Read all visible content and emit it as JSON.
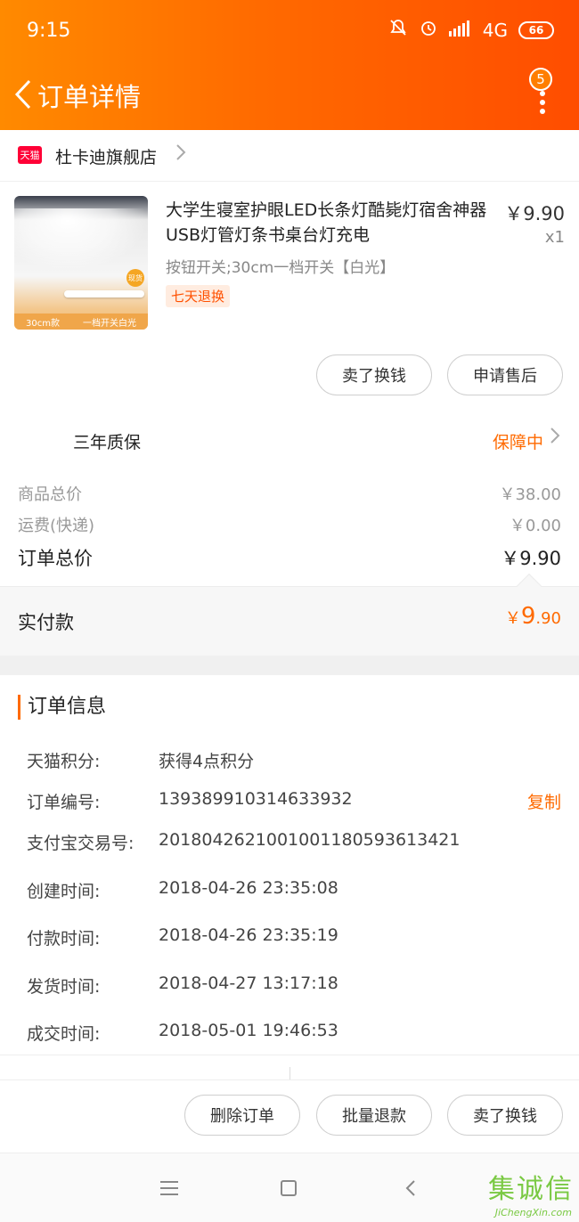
{
  "status_bar": {
    "time": "9:15",
    "network": "4G",
    "battery": "66"
  },
  "nav": {
    "title": "订单详情",
    "badge_count": "5"
  },
  "shop": {
    "platform_logo_text": "天猫",
    "name": "杜卡迪旗舰店"
  },
  "product": {
    "title": "大学生寝室护眼LED长条灯酷毙灯宿舍神器USB灯管灯条书桌台灯充电",
    "spec": "按钮开关;30cm一档开关【白光】",
    "return_tag": "七天退换",
    "price": "￥9.90",
    "quantity": "x1",
    "thumb_caption_left": "30cm款",
    "thumb_caption_right": "一档开关白光",
    "thumb_badge": "现货"
  },
  "product_actions": {
    "sell": "卖了换钱",
    "after_sale": "申请售后"
  },
  "warranty": {
    "label": "三年质保",
    "status": "保障中"
  },
  "price_summary": {
    "goods_label": "商品总价",
    "goods_value": "￥38.00",
    "shipping_label": "运费(快递)",
    "shipping_value": "￥0.00",
    "total_label": "订单总价",
    "total_value": "￥9.90"
  },
  "paid": {
    "label": "实付款",
    "currency": "￥",
    "int": "9",
    "dec": ".90"
  },
  "order_info": {
    "title": "订单信息",
    "points_label": "天猫积分:",
    "points_value": "获得4点积分",
    "order_no_label": "订单编号:",
    "order_no_value": "139389910314633932",
    "copy": "复制",
    "alipay_label": "支付宝交易号:",
    "alipay_value": "2018042621001001180593613421",
    "created_label": "创建时间:",
    "created_value": "2018-04-26 23:35:08",
    "paid_label": "付款时间:",
    "paid_value": "2018-04-26 23:35:19",
    "shipped_label": "发货时间:",
    "shipped_value": "2018-04-27 13:17:18",
    "completed_label": "成交时间:",
    "completed_value": "2018-05-01 19:46:53"
  },
  "bottom_actions": {
    "delete": "删除订单",
    "batch_refund": "批量退款",
    "sell": "卖了换钱"
  },
  "watermark": {
    "chars": "集诚信",
    "domain": "JiChengXin.com"
  },
  "colors": {
    "accent": "#ff6a00",
    "header_start": "#ff8a00",
    "header_end": "#ff4d00",
    "tmall_red": "#ff0036"
  },
  "icons": [
    "back-icon",
    "more-icon",
    "chevron-right-icon",
    "menu-icon",
    "home-icon",
    "back-nav-icon"
  ]
}
